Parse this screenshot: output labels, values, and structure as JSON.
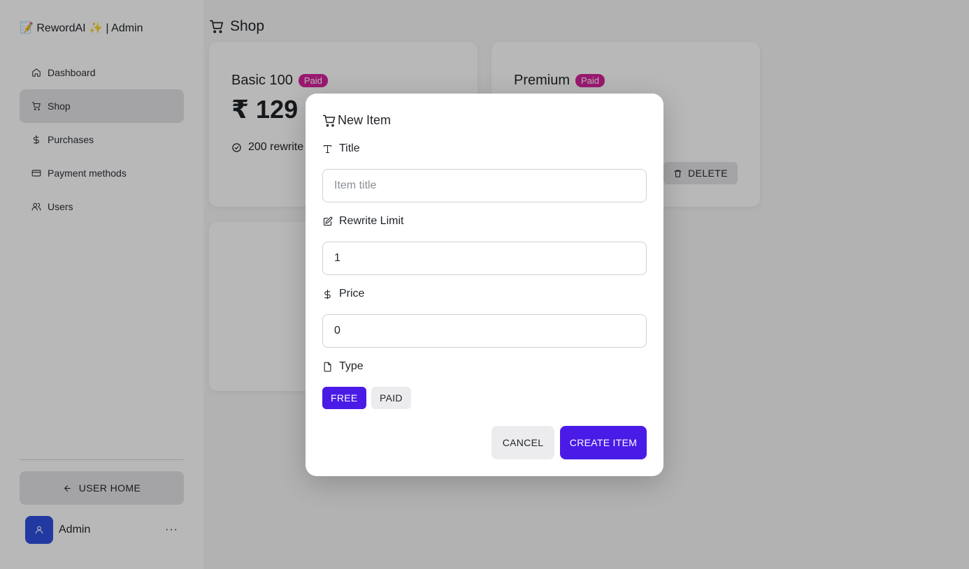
{
  "sidebar": {
    "brand": "📝 RewordAI ✨ | Admin",
    "items": [
      {
        "label": "Dashboard",
        "icon": "home-icon"
      },
      {
        "label": "Shop",
        "icon": "cart-icon",
        "active": true
      },
      {
        "label": "Purchases",
        "icon": "dollar-icon"
      },
      {
        "label": "Payment methods",
        "icon": "credit-card-icon"
      },
      {
        "label": "Users",
        "icon": "users-icon"
      }
    ],
    "user_home_label": "USER HOME",
    "profile_name": "Admin",
    "more_label": "···"
  },
  "header": {
    "title": "Shop"
  },
  "cards": [
    {
      "title": "Basic 100",
      "badge": "Paid",
      "price": "₹ 129",
      "feature": "200 rewrite",
      "delete_label": ""
    },
    {
      "title": "Premium",
      "badge": "Paid",
      "price": "",
      "feature": "",
      "delete_label": "DELETE"
    }
  ],
  "modal": {
    "title": "New Item",
    "title_label": "Title",
    "title_placeholder": "Item title",
    "title_value": "",
    "rewrite_label": "Rewrite Limit",
    "rewrite_value": "1",
    "price_label": "Price",
    "price_value": "0",
    "type_label": "Type",
    "type_options": [
      "FREE",
      "PAID"
    ],
    "type_selected": "FREE",
    "cancel_label": "CANCEL",
    "create_label": "CREATE ITEM"
  },
  "colors": {
    "accent": "#4a1be6",
    "badge": "#d6239c",
    "avatar": "#2f4fe0"
  }
}
